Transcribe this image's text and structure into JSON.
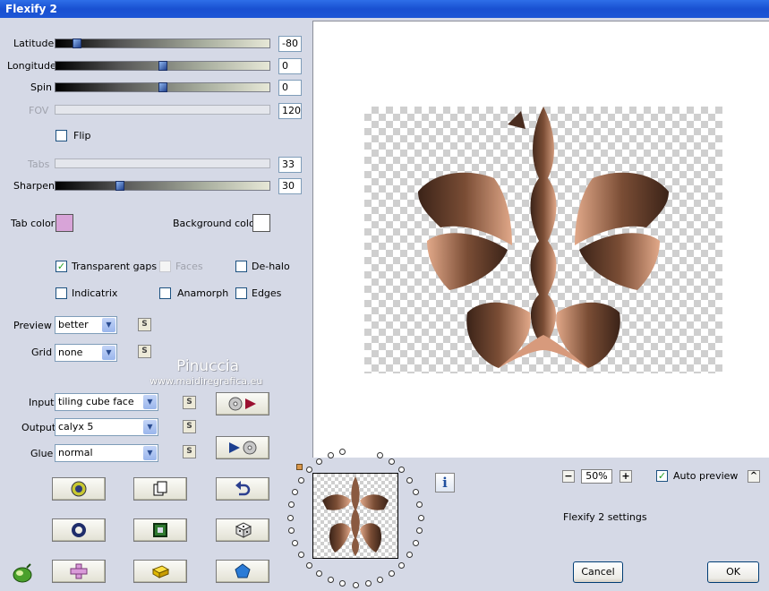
{
  "window": {
    "title": "Flexify 2"
  },
  "params": {
    "latitude": {
      "label": "Latitude",
      "value": "-80",
      "level": 0.1
    },
    "longitude": {
      "label": "Longitude",
      "value": "0",
      "level": 0.5
    },
    "spin": {
      "label": "Spin",
      "value": "0",
      "level": 0.5
    },
    "fov": {
      "label": "FOV",
      "value": "120"
    },
    "flip": {
      "label": "Flip",
      "checked": false
    },
    "tabs": {
      "label": "Tabs",
      "value": "33"
    },
    "sharpen": {
      "label": "Sharpen",
      "value": "30",
      "level": 0.3
    }
  },
  "colors": {
    "tab_color_label": "Tab color",
    "tab_color": "#d8a4d8",
    "background_color_label": "Background color",
    "background_color": "#ffffff"
  },
  "options": {
    "transparent_gaps": {
      "label": "Transparent gaps",
      "checked": true
    },
    "faces": {
      "label": "Faces",
      "checked": false
    },
    "de_halo": {
      "label": "De-halo",
      "checked": false
    },
    "indicatrix": {
      "label": "Indicatrix",
      "checked": false
    },
    "anamorph": {
      "label": "Anamorph",
      "checked": false
    },
    "edges": {
      "label": "Edges",
      "checked": false
    }
  },
  "dropdowns": {
    "preview": {
      "label": "Preview",
      "value": "better"
    },
    "grid": {
      "label": "Grid",
      "value": "none"
    },
    "input": {
      "label": "Input",
      "value": "tiling cube face"
    },
    "output": {
      "label": "Output",
      "value": "calyx 5"
    },
    "glue": {
      "label": "Glue",
      "value": "normal"
    }
  },
  "watermark": {
    "name": "Pinuccia",
    "site": "www.maidiregrafica.eu"
  },
  "zoom": {
    "value": "50%",
    "minus": "−",
    "plus": "+"
  },
  "auto_preview": {
    "label": "Auto preview",
    "checked": true,
    "toggle": "^"
  },
  "settings_name": "Flexify 2 settings",
  "small_button": "S",
  "info_button": "i",
  "buttons": {
    "cancel": "Cancel",
    "ok": "OK"
  }
}
